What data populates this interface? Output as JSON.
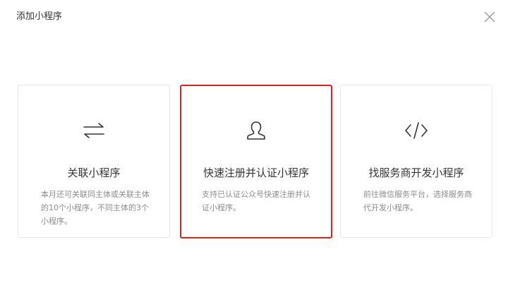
{
  "dialog": {
    "title": "添加小程序"
  },
  "cards": [
    {
      "title": "关联小程序",
      "description": "本月还可关联同主体或关联主体的10个小程序，不同主体的3个小程序。",
      "icon": "swap-arrows-icon"
    },
    {
      "title": "快速注册并认证小程序",
      "description": "支持已认证公众号快速注册并认证小程序。",
      "icon": "user-icon",
      "selected": true
    },
    {
      "title": "找服务商开发小程序",
      "description": "前往微信服务平台，选择服务商代开发小程序。",
      "icon": "code-icon"
    }
  ],
  "colors": {
    "selected_border": "#e0201f",
    "card_border": "#e7e7eb",
    "text_primary": "#353535",
    "text_secondary": "#8d8d8d"
  }
}
